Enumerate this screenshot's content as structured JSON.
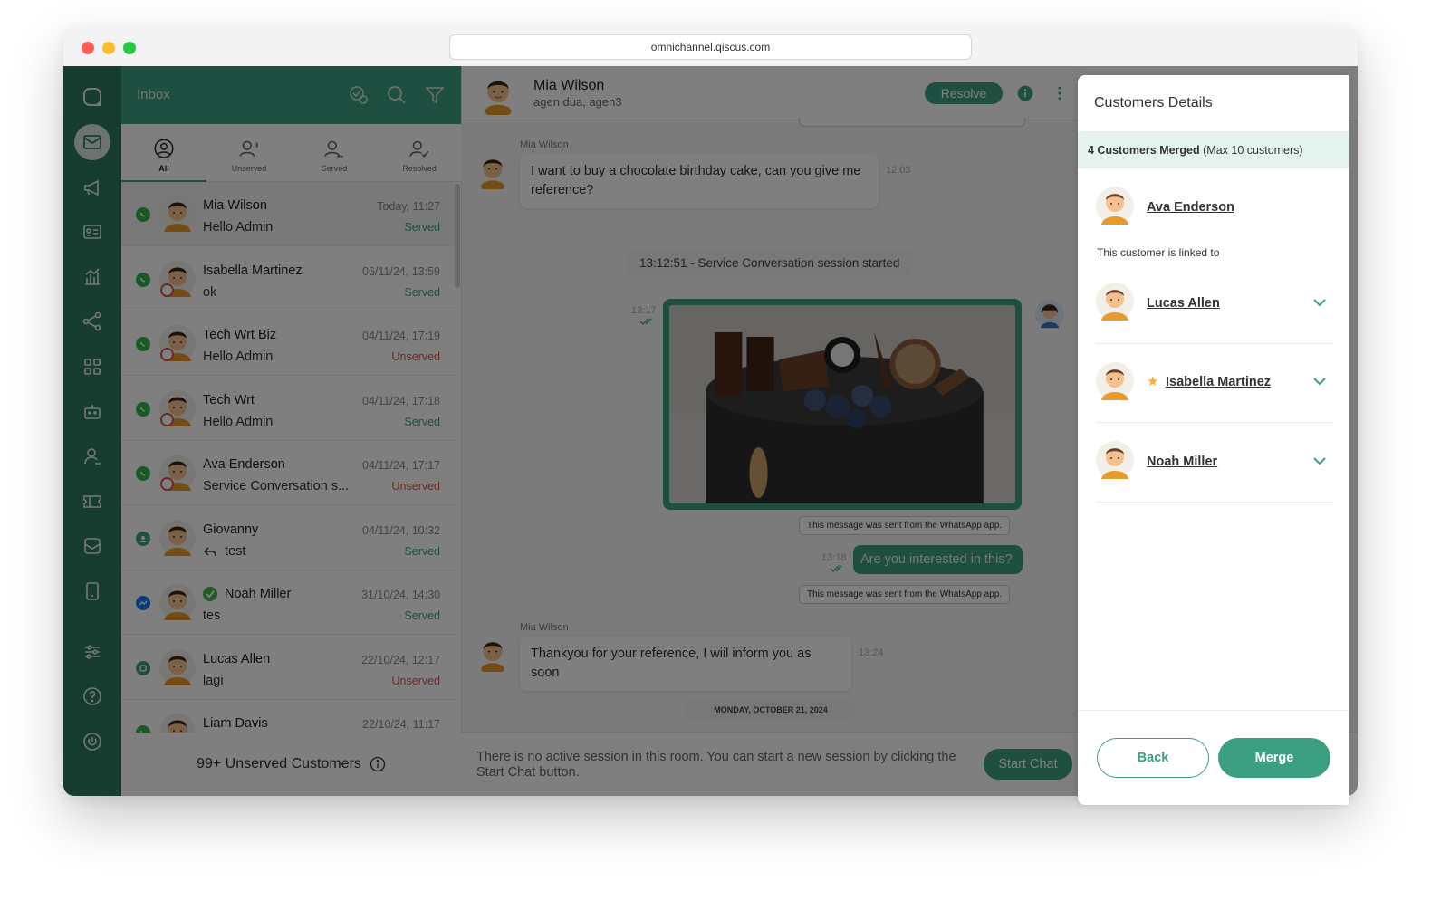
{
  "browser": {
    "url": "omnichannel.qiscus.com"
  },
  "rail": {
    "items": [
      "logo-icon",
      "inbox-icon",
      "megaphone-icon",
      "contacts-icon",
      "analytics-icon",
      "integration-icon",
      "apps-icon",
      "bot-icon",
      "agent-icon",
      "ticket-icon",
      "mailbox-icon",
      "mobile-icon",
      "settings-icon",
      "help-icon",
      "power-icon"
    ]
  },
  "inbox": {
    "title": "Inbox",
    "tabs": [
      {
        "label": "All"
      },
      {
        "label": "Unserved"
      },
      {
        "label": "Served"
      },
      {
        "label": "Resolved"
      }
    ],
    "rows": [
      {
        "name": "Mia Wilson",
        "message": "Hello Admin",
        "time": "Today, 11:27",
        "status": "Served",
        "channel": "whatsapp"
      },
      {
        "name": "Isabella Martinez",
        "message": "ok",
        "time": "06/11/24, 13:59",
        "status": "Served",
        "channel": "whatsapp"
      },
      {
        "name": "Tech Wrt Biz",
        "message": "Hello Admin",
        "time": "04/11/24, 17:19",
        "status": "Unserved",
        "channel": "whatsapp"
      },
      {
        "name": "Tech Wrt",
        "message": "Hello Admin",
        "time": "04/11/24, 17:18",
        "status": "Served",
        "channel": "whatsapp"
      },
      {
        "name": "Ava Enderson",
        "message": "Service Conversation s...",
        "time": "04/11/24, 17:17",
        "status": "Unserved",
        "channel": "whatsapp"
      },
      {
        "name": "Giovanny",
        "message": "test",
        "time": "04/11/24, 10:32",
        "status": "Served",
        "channel": "agent"
      },
      {
        "name": "Noah Miller",
        "message": "tes",
        "time": "31/10/24, 14:30",
        "status": "Served",
        "channel": "messenger"
      },
      {
        "name": "Lucas Allen",
        "message": "lagi",
        "time": "22/10/24, 12:17",
        "status": "Unserved",
        "channel": "qiscus"
      },
      {
        "name": "Liam Davis",
        "message": "",
        "time": "22/10/24, 11:17",
        "status": "",
        "channel": "whatsapp"
      }
    ],
    "footer": "99+ Unserved Customers"
  },
  "chat": {
    "name": "Mia Wilson",
    "agents": "agen dua, agen3",
    "resolve_label": "Resolve",
    "messages": {
      "m1_sender": "Mia Wilson",
      "m1_text": "I want to buy a chocolate birthday cake, can you give me reference?",
      "m1_time": "12:03",
      "session_started": "13:12:51 - Service Conversation session started",
      "img_time": "13:17",
      "wa_note_1": "This message was sent from the WhatsApp app.",
      "r1_time": "13:18",
      "r1_text": "Are you interested in this?",
      "wa_note_2": "This message was sent from the WhatsApp app.",
      "m2_sender": "Mia Wilson",
      "m2_text": "Thankyou for your reference, I wiil inform you as soon",
      "m2_time": "13:24",
      "date_divider": "MONDAY, OCTOBER 21, 2024"
    },
    "footer_text": "There is no active session in this room. You can start a new session by clicking the Start Chat button.",
    "start_chat_label": "Start Chat"
  },
  "drawer": {
    "title": "Customers Details",
    "merged_count": "4 Customers Merged",
    "merged_max": "(Max 10 customers)",
    "primary_customer": "Ava Enderson",
    "linked_text": "This customer is linked to",
    "linked_customers": [
      {
        "name": "Lucas Allen",
        "starred": false
      },
      {
        "name": "Isabella Martinez",
        "starred": true
      },
      {
        "name": "Noah Miller",
        "starred": false
      }
    ],
    "back_label": "Back",
    "merge_label": "Merge"
  },
  "colors": {
    "brand": "#3d9f81",
    "rail": "#2f7a63",
    "unserved": "#d9534f",
    "star": "#f0ad2e"
  }
}
